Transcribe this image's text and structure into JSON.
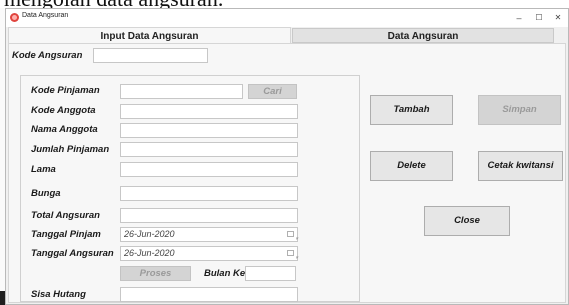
{
  "background_caption": "mengolah data angsuran.",
  "window": {
    "title": "Data Angsuran",
    "controls": {
      "minimize": "–",
      "maximize": "☐",
      "close": "✕"
    }
  },
  "tabs": [
    {
      "label": "Input Data Angsuran",
      "active": true
    },
    {
      "label": "Data Angsuran",
      "active": false
    }
  ],
  "form": {
    "kode_angsuran": {
      "label": "Kode Angsuran",
      "value": ""
    },
    "kode_pinjaman": {
      "label": "Kode Pinjaman",
      "value": ""
    },
    "cari_label": "Cari",
    "kode_anggota": {
      "label": "Kode Anggota",
      "value": ""
    },
    "nama_anggota": {
      "label": "Nama Anggota",
      "value": ""
    },
    "jumlah_pinjaman": {
      "label": "Jumlah Pinjaman",
      "value": ""
    },
    "lama": {
      "label": "Lama",
      "value": ""
    },
    "bunga": {
      "label": "Bunga",
      "value": ""
    },
    "total_angsuran": {
      "label": "Total Angsuran",
      "value": ""
    },
    "tanggal_pinjam": {
      "label": "Tanggal Pinjam",
      "value": "26-Jun-2020"
    },
    "tanggal_angsuran": {
      "label": "Tanggal Angsuran",
      "value": "26-Jun-2020"
    },
    "proses_label": "Proses",
    "bulan_ke": {
      "label": "Bulan Ke",
      "value": ""
    },
    "sisa_hutang": {
      "label": "Sisa Hutang",
      "value": ""
    }
  },
  "actions": {
    "tambah": "Tambah",
    "simpan": "Simpan",
    "delete": "Delete",
    "cetak": "Cetak kwitansi",
    "close": "Close"
  }
}
